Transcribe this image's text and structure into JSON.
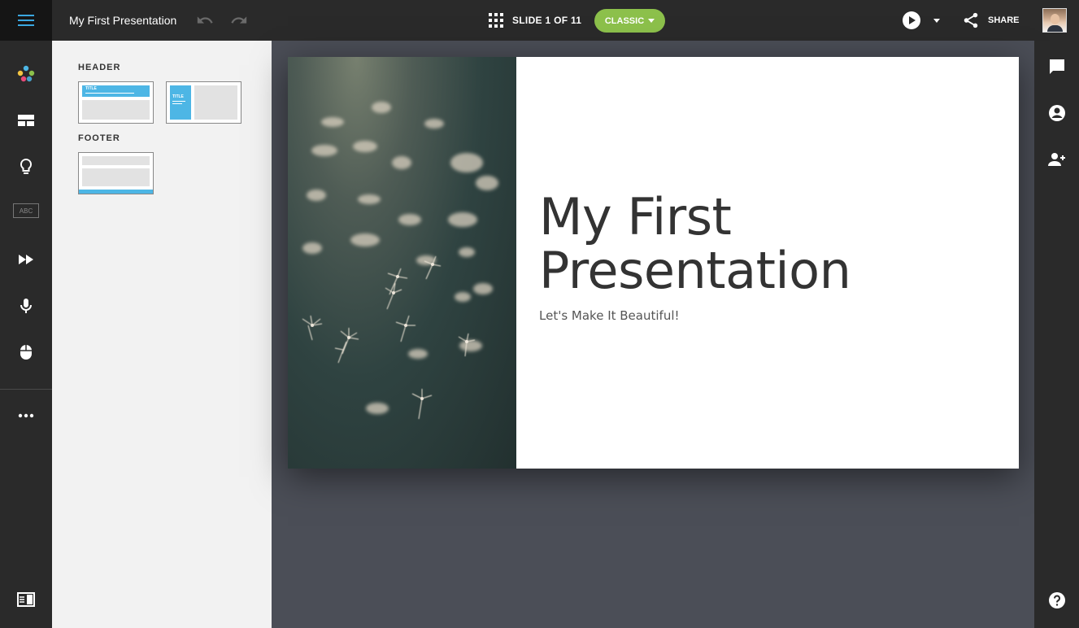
{
  "header": {
    "presentation_title": "My First Presentation",
    "slide_counter": "SLIDE 1 OF 11",
    "theme_button": "CLASSIC",
    "share_label": "SHARE",
    "icons": [
      "menu-icon",
      "undo-icon",
      "redo-icon",
      "grid-icon",
      "play-icon",
      "chevron-down-icon",
      "share-icon",
      "user-avatar"
    ]
  },
  "left_rail": {
    "icons": [
      "palette-icon",
      "layout-icon",
      "lightbulb-icon",
      "text-style-icon",
      "transition-icon",
      "microphone-icon",
      "mouse-icon",
      "more-icon",
      "panel-toggle-icon"
    ],
    "text_style_label": "ABC"
  },
  "layout_panel": {
    "header_section": "HEADER",
    "footer_section": "FOOTER",
    "thumb_title_label": "TITLE"
  },
  "slide": {
    "title": "My First Presentation",
    "subtitle": "Let's Make It Beautiful!"
  },
  "right_rail": {
    "icons": [
      "comment-icon",
      "user-circle-icon",
      "add-user-icon",
      "help-icon"
    ]
  },
  "colors": {
    "accent_green": "#8cc04b",
    "layout_blue": "#4db6e5",
    "menu_blue": "#3aa7e0"
  }
}
